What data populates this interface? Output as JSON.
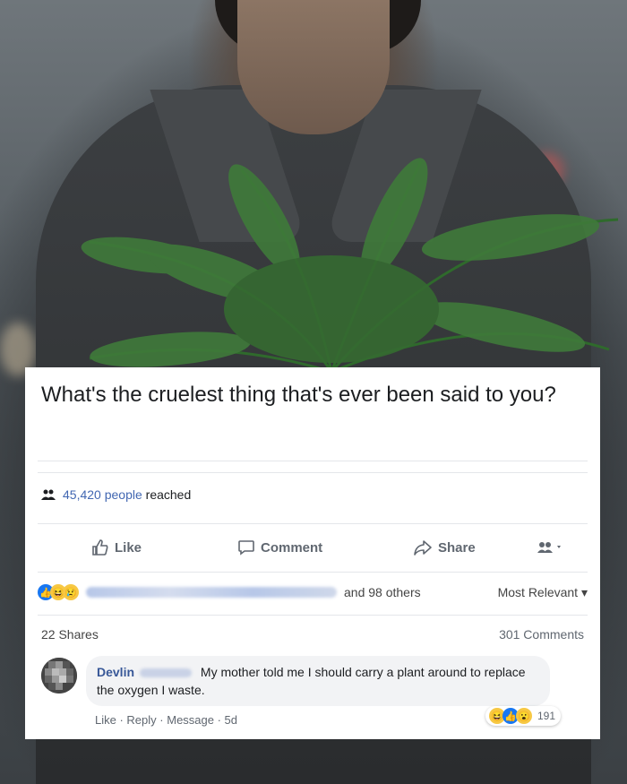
{
  "post": {
    "question": "What's the cruelest thing that's ever been said to you?",
    "reach_count": "45,420 people",
    "reach_suffix": "reached"
  },
  "actions": {
    "like": "Like",
    "comment": "Comment",
    "share": "Share"
  },
  "reactions": {
    "others_text": "and 98 others",
    "sort_label": "Most Relevant ▾"
  },
  "counts": {
    "shares": "22 Shares",
    "comments": "301 Comments"
  },
  "comment": {
    "author": "Devlin",
    "text": "My mother told me I should carry a plant around to replace the oxygen I waste.",
    "like": "Like",
    "reply": "Reply",
    "message": "Message",
    "time": "5d",
    "reaction_count": "191"
  },
  "colors": {
    "link_blue": "#4267b2",
    "author_blue": "#385898",
    "gray_text": "#606770",
    "fern_green": "#3f7a3a"
  },
  "icons": {
    "reach": "people-icon",
    "like": "thumbs-up-icon",
    "comment": "speech-bubble-icon",
    "share": "share-arrow-icon",
    "audience": "audience-selector-icon"
  }
}
